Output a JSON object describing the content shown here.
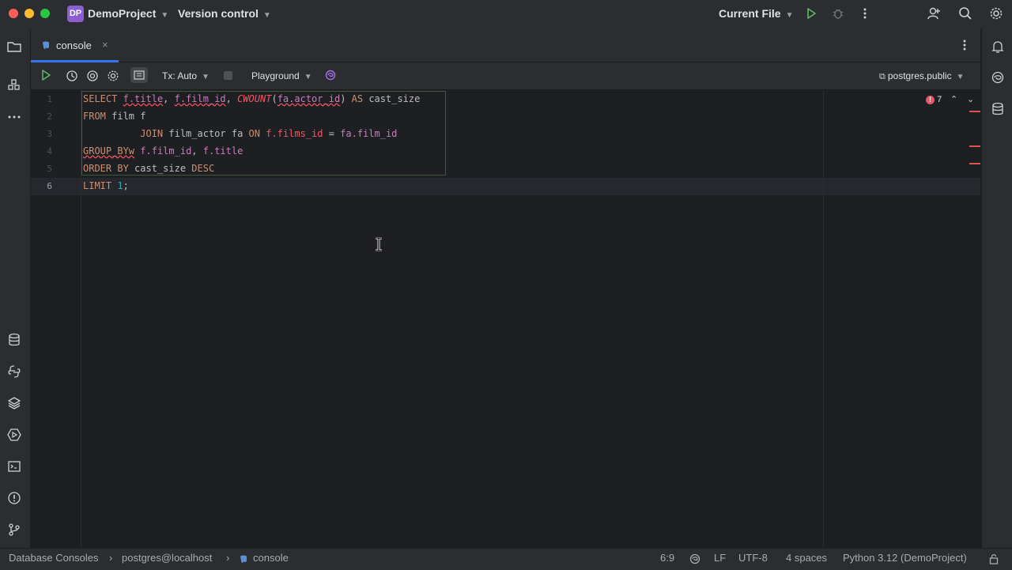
{
  "titlebar": {
    "project_badge": "DP",
    "project_name": "DemoProject",
    "vcs_label": "Version control",
    "run_config": "Current File"
  },
  "tab": {
    "label": "console"
  },
  "toolbar": {
    "tx_label": "Tx: Auto",
    "playground_label": "Playground",
    "schema_label": "postgres.public"
  },
  "editor": {
    "line_numbers": [
      "1",
      "2",
      "3",
      "4",
      "5",
      "6"
    ],
    "error_count": "7",
    "lines": {
      "l1": {
        "select": "SELECT",
        "sp1": " ",
        "f_title": "f.title",
        "comma1": ", ",
        "f_film_id": "f.film_id",
        "comma2": ", ",
        "cwount": "CWOUNT",
        "paren_open": "(",
        "fa_actor_id": "fa.actor_id",
        "paren_close": ")",
        "sp2": " ",
        "as": "AS",
        "alias": " cast_size"
      },
      "l2": {
        "from": "FROM",
        "rest": " film f"
      },
      "l3": {
        "indent": "          ",
        "join": "JOIN",
        "table": " film_actor fa ",
        "on": "ON",
        "sp": " ",
        "f_films_id": "f.films_id",
        "eq": " = ",
        "fa_film_id": "fa.film_id"
      },
      "l4": {
        "group": "GROUP_BYw",
        "sp": " ",
        "f_film_id": "f.film_id",
        "comma": ", ",
        "f_title": "f.title"
      },
      "l5": {
        "order": "ORDER BY",
        "alias": " cast_size ",
        "desc": "DESC"
      },
      "l6": {
        "limit": "LIMIT",
        "sp": " ",
        "num": "1",
        "semi": ";"
      }
    }
  },
  "statusbar": {
    "crumb1": "Database Consoles",
    "crumb2": "postgres@localhost",
    "crumb3": "console",
    "position": "6:9",
    "line_sep": "LF",
    "encoding": "UTF-8",
    "indent": "4 spaces",
    "interpreter": "Python 3.12 (DemoProject)"
  },
  "colors": {
    "accent": "#3574f0",
    "keyword": "#cf8e6d",
    "field": "#c77dbb",
    "error": "#f75464",
    "run_green": "#5fb865"
  }
}
